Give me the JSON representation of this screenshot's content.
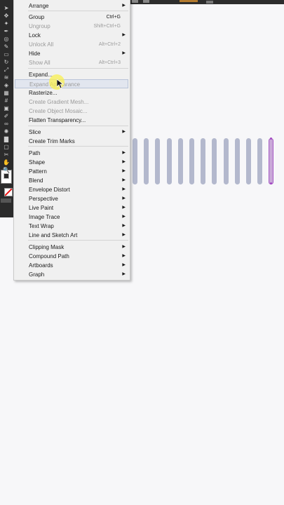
{
  "menu": {
    "items": [
      {
        "label": "Arrange",
        "shortcut": "",
        "submenu": true,
        "disabled": false
      },
      {
        "label": "Group",
        "shortcut": "Ctrl+G",
        "submenu": false,
        "disabled": false
      },
      {
        "label": "Ungroup",
        "shortcut": "Shift+Ctrl+G",
        "submenu": false,
        "disabled": true
      },
      {
        "label": "Lock",
        "shortcut": "",
        "submenu": true,
        "disabled": false
      },
      {
        "label": "Unlock All",
        "shortcut": "Alt+Ctrl+2",
        "submenu": false,
        "disabled": true
      },
      {
        "label": "Hide",
        "shortcut": "",
        "submenu": true,
        "disabled": false
      },
      {
        "label": "Show All",
        "shortcut": "Alt+Ctrl+3",
        "submenu": false,
        "disabled": true
      },
      {
        "label": "Expand...",
        "shortcut": "",
        "submenu": false,
        "disabled": false
      },
      {
        "label": "Expand Appearance",
        "shortcut": "",
        "submenu": false,
        "disabled": true
      },
      {
        "label": "Rasterize...",
        "shortcut": "",
        "submenu": false,
        "disabled": false
      },
      {
        "label": "Create Gradient Mesh...",
        "shortcut": "",
        "submenu": false,
        "disabled": true
      },
      {
        "label": "Create Object Mosaic...",
        "shortcut": "",
        "submenu": false,
        "disabled": true
      },
      {
        "label": "Flatten Transparency...",
        "shortcut": "",
        "submenu": false,
        "disabled": false
      },
      {
        "label": "Slice",
        "shortcut": "",
        "submenu": true,
        "disabled": false
      },
      {
        "label": "Create Trim Marks",
        "shortcut": "",
        "submenu": false,
        "disabled": false
      },
      {
        "label": "Path",
        "shortcut": "",
        "submenu": true,
        "disabled": false
      },
      {
        "label": "Shape",
        "shortcut": "",
        "submenu": true,
        "disabled": false
      },
      {
        "label": "Pattern",
        "shortcut": "",
        "submenu": true,
        "disabled": false
      },
      {
        "label": "Blend",
        "shortcut": "",
        "submenu": true,
        "disabled": false
      },
      {
        "label": "Envelope Distort",
        "shortcut": "",
        "submenu": true,
        "disabled": false
      },
      {
        "label": "Perspective",
        "shortcut": "",
        "submenu": true,
        "disabled": false
      },
      {
        "label": "Live Paint",
        "shortcut": "",
        "submenu": true,
        "disabled": false
      },
      {
        "label": "Image Trace",
        "shortcut": "",
        "submenu": true,
        "disabled": false
      },
      {
        "label": "Text Wrap",
        "shortcut": "",
        "submenu": true,
        "disabled": false
      },
      {
        "label": "Line and Sketch Art",
        "shortcut": "",
        "submenu": true,
        "disabled": false
      },
      {
        "label": "Clipping Mask",
        "shortcut": "",
        "submenu": true,
        "disabled": false
      },
      {
        "label": "Compound Path",
        "shortcut": "",
        "submenu": true,
        "disabled": false
      },
      {
        "label": "Artboards",
        "shortcut": "",
        "submenu": true,
        "disabled": false
      },
      {
        "label": "Graph",
        "shortcut": "",
        "submenu": true,
        "disabled": false
      }
    ],
    "hovered_index": 8,
    "submenu_glyph": "▶"
  },
  "canvas": {
    "bar_count": 13,
    "selected_bar_index": 12,
    "bar_color": "#b3b8cd",
    "selection_color": "#a65ac5"
  },
  "tools": {
    "icons": [
      "selection-icon",
      "direct-selection-icon",
      "magic-wand-icon",
      "pen-icon",
      "ellipse-icon",
      "paintbrush-icon",
      "eraser-icon",
      "rotate-icon",
      "scale-icon",
      "width-icon",
      "shape-builder-icon",
      "perspective-grid-icon",
      "mesh-icon",
      "gradient-icon",
      "eyedropper-icon",
      "blend-icon",
      "symbol-sprayer-icon",
      "graph-icon",
      "artboard-icon",
      "slice-icon",
      "hand-icon",
      "zoom-icon"
    ]
  }
}
